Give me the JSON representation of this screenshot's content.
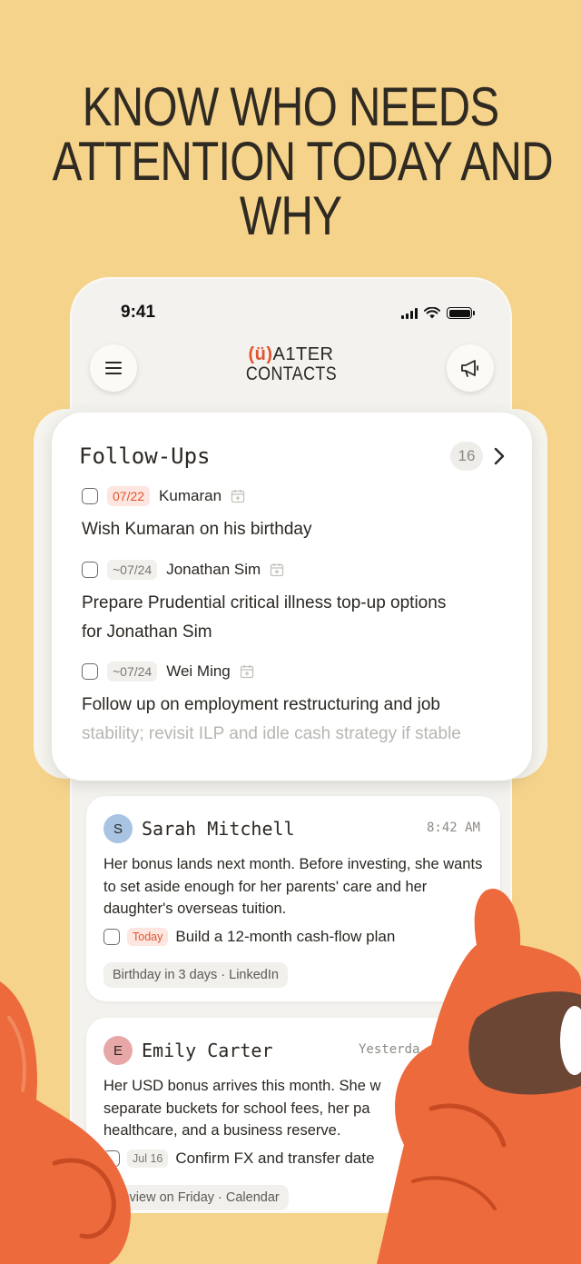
{
  "headline": [
    "KNOW WHO NEEDS",
    "ATTENTION TODAY AND",
    "WHY"
  ],
  "status_bar": {
    "time": "9:41"
  },
  "app": {
    "logo_mark": "(ü)",
    "logo_line1": "A1TER",
    "logo_line2": "CONTACTS"
  },
  "icons": {
    "menu": "hamburger-menu-icon",
    "announce": "megaphone-icon",
    "calendar": "calendar-add-icon",
    "chevron": "chevron-right-icon"
  },
  "colors": {
    "background": "#f5d38b",
    "accent": "#e1542f",
    "card": "#ffffff"
  },
  "followups": {
    "title": "Follow-Ups",
    "count": "16",
    "items": [
      {
        "date": "07/22",
        "urgent": true,
        "name": "Kumaran",
        "text": "Wish Kumaran on his birthday"
      },
      {
        "date": "~07/24",
        "urgent": false,
        "name": "Jonathan Sim",
        "text_line1": "Prepare Prudential critical illness top-up options",
        "text_line2": "for Jonathan Sim"
      },
      {
        "date": "~07/24",
        "urgent": false,
        "name": "Wei Ming",
        "text_line1": "Follow up on employment restructuring and job",
        "text_line2": "stability; revisit ILP and idle cash strategy if stable"
      }
    ]
  },
  "feed": [
    {
      "initial": "S",
      "name": "Sarah Mitchell",
      "time": "8:42 AM",
      "note": "Her bonus lands next month. Before investing, she wants to set aside enough for her parents' care and her daughter's overseas tuition.",
      "task_tag": "Today",
      "task": "Build a 12-month cash-flow plan",
      "chip": "Birthday in 3 days · LinkedIn"
    },
    {
      "initial": "E",
      "name": "Emily Carter",
      "time": "Yesterda",
      "note_line1": "Her USD bonus arrives this month. She w",
      "note_line2": "separate buckets for school fees, her pa",
      "note_line3": "healthcare, and a business reserve.",
      "task_tag": "Jul 16",
      "task": "Confirm FX and transfer date",
      "chip": "Review on Friday · Calendar"
    }
  ]
}
